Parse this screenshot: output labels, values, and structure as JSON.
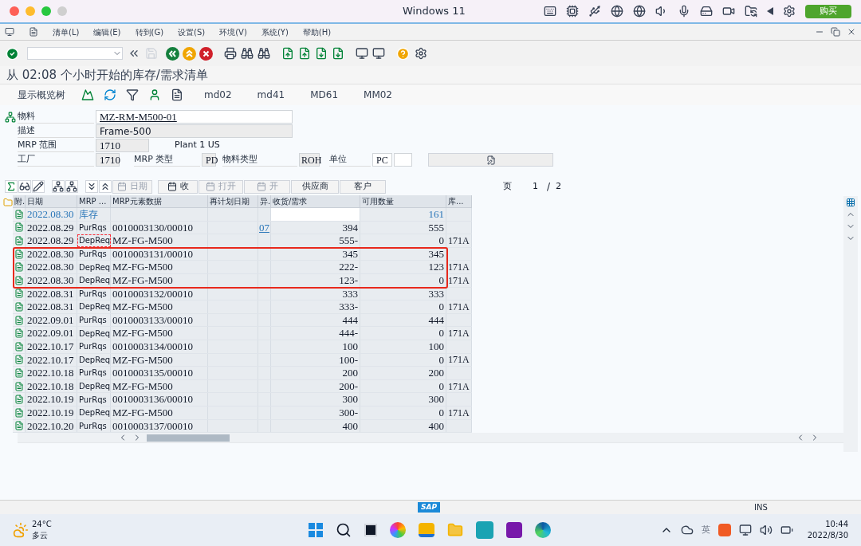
{
  "vm_window": {
    "title": "Windows 11",
    "buy_button": "购买"
  },
  "menu": [
    "清单(L)",
    "编辑(E)",
    "转到(G)",
    "设置(S)",
    "环境(V)",
    "系统(Y)",
    "帮助(H)"
  ],
  "screen_title": "从 02:08 个小时开始的库存/需求清单",
  "app_toolbar": {
    "tree_button": "显示概览树",
    "transactions": [
      "md02",
      "md41",
      "MD61",
      "MM02"
    ]
  },
  "header": {
    "material_label": "物料",
    "material": "MZ-RM-M500-01",
    "desc_label": "描述",
    "desc": "Frame-500",
    "area_label": "MRP 范围",
    "area": "1710",
    "area_name": "Plant 1 US",
    "plant_label": "工厂",
    "plant": "1710",
    "mrp_type_label": "MRP 类型",
    "mrp_type": "PD",
    "mat_type_label": "物料类型",
    "mat_type": "ROH",
    "unit_label": "单位",
    "unit": "PC"
  },
  "alv_toolbar": {
    "buttons": [
      {
        "label": "日期",
        "disabled": true
      },
      {
        "label": "收",
        "disabled": false
      },
      {
        "label": "打开",
        "disabled": true
      },
      {
        "label": "开",
        "disabled": true
      },
      {
        "label": "供应商",
        "disabled": false
      },
      {
        "label": "客户",
        "disabled": false
      }
    ],
    "page_label": "页",
    "page": "1",
    "page_separator": "/",
    "pages": "2"
  },
  "table": {
    "columns": [
      "附.",
      "日期",
      "MRP ...",
      "MRP元素数据",
      "再计划日期",
      "异.",
      "收货/需求",
      "可用数量",
      "库..."
    ],
    "rows": [
      {
        "kind": "stock",
        "date": "2022.08.30",
        "mrp": "库存",
        "available": "161",
        "highlighted": false,
        "marked": false
      },
      {
        "kind": "element",
        "date": "2022.08.29",
        "mrp": "PurRqs",
        "element": "0010003130/00010",
        "exception": "07",
        "qty": "394",
        "available": "555",
        "highlighted": false,
        "marked": false
      },
      {
        "kind": "element",
        "date": "2022.08.29",
        "mrp": "DepReq",
        "element": "MZ-FG-M500",
        "qty": "555-",
        "available": "0",
        "storage": "171A",
        "highlighted": false,
        "marked": true
      },
      {
        "kind": "element",
        "date": "2022.08.30",
        "mrp": "PurRqs",
        "element": "0010003131/00010",
        "qty": "345",
        "available": "345",
        "highlighted": true,
        "marked": false
      },
      {
        "kind": "element",
        "date": "2022.08.30",
        "mrp": "DepReq",
        "element": "MZ-FG-M500",
        "qty": "222-",
        "available": "123",
        "storage": "171A",
        "highlighted": true,
        "marked": false
      },
      {
        "kind": "element",
        "date": "2022.08.30",
        "mrp": "DepReq",
        "element": "MZ-FG-M500",
        "qty": "123-",
        "available": "0",
        "storage": "171A",
        "highlighted": true,
        "marked": false
      },
      {
        "kind": "element",
        "date": "2022.08.31",
        "mrp": "PurRqs",
        "element": "0010003132/00010",
        "qty": "333",
        "available": "333",
        "highlighted": false,
        "marked": false
      },
      {
        "kind": "element",
        "date": "2022.08.31",
        "mrp": "DepReq",
        "element": "MZ-FG-M500",
        "qty": "333-",
        "available": "0",
        "storage": "171A",
        "highlighted": false,
        "marked": false
      },
      {
        "kind": "element",
        "date": "2022.09.01",
        "mrp": "PurRqs",
        "element": "0010003133/00010",
        "qty": "444",
        "available": "444",
        "highlighted": false,
        "marked": false
      },
      {
        "kind": "element",
        "date": "2022.09.01",
        "mrp": "DepReq",
        "element": "MZ-FG-M500",
        "qty": "444-",
        "available": "0",
        "storage": "171A",
        "highlighted": false,
        "marked": false
      },
      {
        "kind": "element",
        "date": "2022.10.17",
        "mrp": "PurRqs",
        "element": "0010003134/00010",
        "qty": "100",
        "available": "100",
        "highlighted": false,
        "marked": false
      },
      {
        "kind": "element",
        "date": "2022.10.17",
        "mrp": "DepReq",
        "element": "MZ-FG-M500",
        "qty": "100-",
        "available": "0",
        "storage": "171A",
        "highlighted": false,
        "marked": false
      },
      {
        "kind": "element",
        "date": "2022.10.18",
        "mrp": "PurRqs",
        "element": "0010003135/00010",
        "qty": "200",
        "available": "200",
        "highlighted": false,
        "marked": false
      },
      {
        "kind": "element",
        "date": "2022.10.18",
        "mrp": "DepReq",
        "element": "MZ-FG-M500",
        "qty": "200-",
        "available": "0",
        "storage": "171A",
        "highlighted": false,
        "marked": false
      },
      {
        "kind": "element",
        "date": "2022.10.19",
        "mrp": "PurRqs",
        "element": "0010003136/00010",
        "qty": "300",
        "available": "300",
        "highlighted": false,
        "marked": false
      },
      {
        "kind": "element",
        "date": "2022.10.19",
        "mrp": "DepReq",
        "element": "MZ-FG-M500",
        "qty": "300-",
        "available": "0",
        "storage": "171A",
        "highlighted": false,
        "marked": false
      },
      {
        "kind": "element",
        "date": "2022.10.20",
        "mrp": "PurRqs",
        "element": "0010003137/00010",
        "qty": "400",
        "available": "400",
        "highlighted": false,
        "marked": false
      }
    ]
  },
  "status_bar": {
    "logo": "SAP",
    "mode": "INS"
  },
  "taskbar": {
    "temperature": "24°C",
    "weather": "多云",
    "ime": "英",
    "time": "10:44",
    "date": "2022/8/30"
  }
}
